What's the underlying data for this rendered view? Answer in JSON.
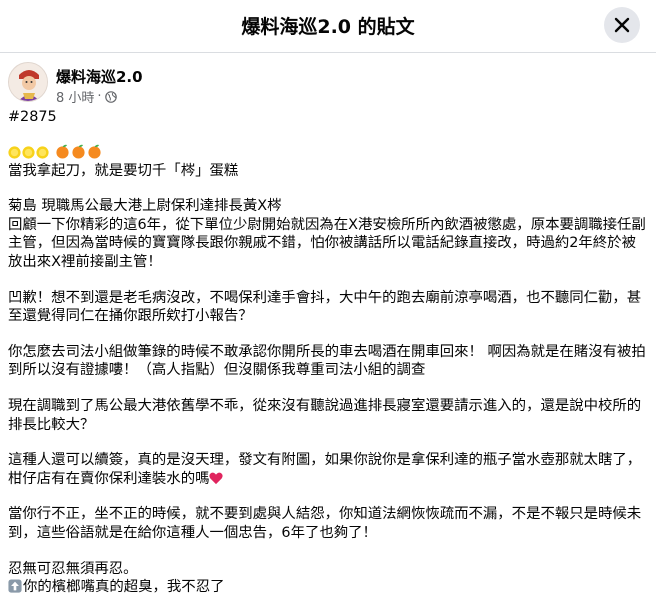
{
  "header": {
    "title": "爆料海巡2.0 的貼文",
    "close_icon": "close-icon"
  },
  "post": {
    "author": "爆料海巡2.0",
    "time": "8 小時",
    "separator": "·",
    "privacy_icon": "globe-icon"
  },
  "body": {
    "tag": "#2875",
    "emoji_line": [
      "sun",
      "sun",
      "sun",
      "orange",
      "orange",
      "orange"
    ],
    "line1": "當我拿起刀，就是要切千「梣」蛋糕",
    "line2": "菊島 現職馬公最大港上尉保利達排長黃X梣",
    "para1": "回顧一下你精彩的這6年，從下單位少尉開始就因為在X港安檢所所內飲酒被懲處，原本要調職接任副主管，但因為當時候的寶寶隊長跟你親戚不錯，怕你被講話所以電話紀錄直接改，時過約2年終於被放出來X裡前接副主管！",
    "para2": "凹歉！想不到還是老毛病沒改，不喝保利達手會抖，大中午的跑去廟前涼亭喝酒，也不聽同仁勸，甚至還覺得同仁在捅你跟所欸打小報告？",
    "para3": "你怎麼去司法小組做筆錄的時候不敢承認你開所長的車去喝酒在開車回來！ 啊因為就是在賭沒有被拍到所以沒有證據嘍！（高人指點）但沒關係我尊重司法小組的調查",
    "para4": "現在調職到了馬公最大港依舊學不乖，從來沒有聽說過進排長寢室還要請示進入的，還是說中校所的排長比較大？",
    "para5": "這種人還可以續簽，真的是沒天理，發文有附圖，如果你說你是拿保利達的瓶子當水壺那就太瞎了，柑仔店有在賣你保利達裝水的嗎",
    "para5_heart": "heart-icon",
    "para6": "當你行不正，坐不正的時候，就不要到處與人結怨，你知道法網恢恢疏而不漏，不是不報只是時候未到，這些俗語就是在給你這種人一個忠告，6年了也夠了！",
    "line_end1": "忍無可忍無須再忍。",
    "line_end2": "你的檳榔嘴真的超臭，我不忍了",
    "line_end2_icon": "up-arrow-box-icon"
  },
  "colors": {
    "heart": "#e0245e",
    "meta": "#65676b",
    "divider": "#dadde1"
  }
}
